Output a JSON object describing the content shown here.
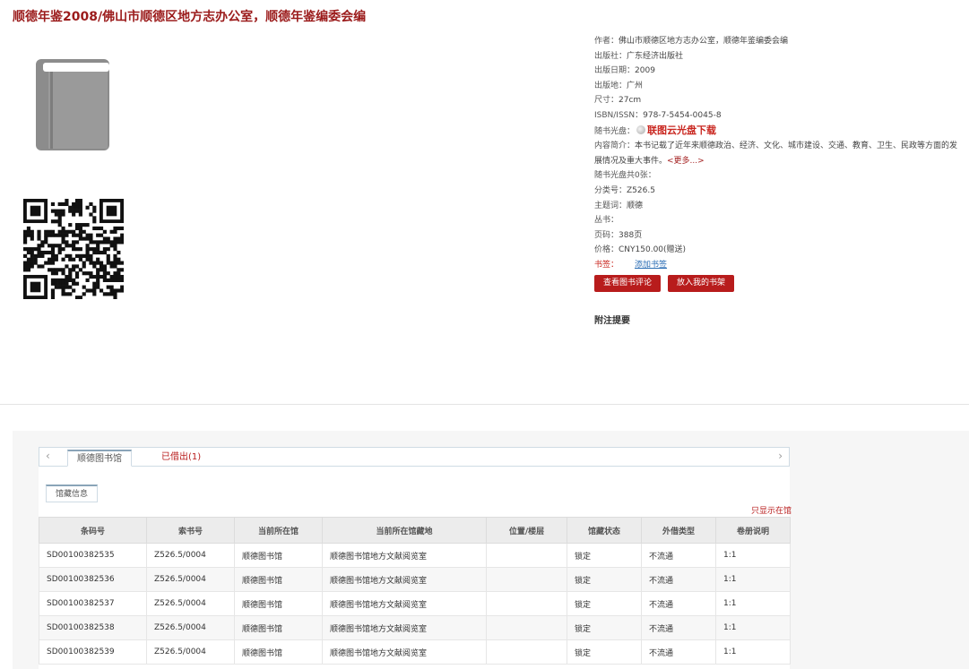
{
  "page": {
    "title": "顺德年鉴2008/佛山市顺德区地方志办公室，顺德年鉴编委会编"
  },
  "book_details": [
    {
      "label": "作者：",
      "value": "佛山市顺德区地方志办公室，顺德年鉴编委会编"
    },
    {
      "label": "出版社：",
      "value": "广东经济出版社"
    },
    {
      "label": "出版日期：",
      "value": "2009"
    },
    {
      "label": "出版地：",
      "value": "广州"
    },
    {
      "label": "尺寸：",
      "value": "27cm"
    },
    {
      "label": "ISBN/ISSN：",
      "value": "978-7-5454-0045-8"
    }
  ],
  "disc": {
    "label": "随书光盘：",
    "icon": "disc-icon",
    "link": "联图云光盘下载"
  },
  "description": {
    "label": "内容简介：",
    "text": "本书记载了近年来顺德政治、经济、文化、城市建设、交通、教育、卫生、民政等方面的发展情况及重大事件。",
    "more": "<更多...>"
  },
  "more_details": [
    {
      "label": "随书光盘共0张：",
      "value": ""
    },
    {
      "label": "分类号：",
      "value": "Z526.5"
    },
    {
      "label": "主题词：",
      "value": "顺德"
    },
    {
      "label": "丛书：",
      "value": ""
    },
    {
      "label": "页码：",
      "value": "388页"
    },
    {
      "label": "价格：",
      "value": "CNY150.00(赠送)"
    }
  ],
  "bookmark": {
    "label": "书签：",
    "link": "添加书签"
  },
  "actions": {
    "review": "查看图书评论",
    "shelf": "放入我的书架"
  },
  "notes_heading": "附注提要",
  "tabs": {
    "active": "顺德图书馆",
    "inactive": "已借出(1)",
    "left_arrow": "‹",
    "right_arrow": "›"
  },
  "subtab": "馆藏信息",
  "only_show": "只显示在馆",
  "holdings": {
    "headers": [
      "条码号",
      "索书号",
      "当前所在馆",
      "当前所在馆藏地",
      "位置/楼层",
      "馆藏状态",
      "外借类型",
      "卷册说明"
    ],
    "rows": [
      [
        "SD00100382535",
        "Z526.5/0004",
        "顺德图书馆",
        "顺德图书馆地方文献阅览室",
        "",
        "锁定",
        "不流通",
        "1:1"
      ],
      [
        "SD00100382536",
        "Z526.5/0004",
        "顺德图书馆",
        "顺德图书馆地方文献阅览室",
        "",
        "锁定",
        "不流通",
        "1:1"
      ],
      [
        "SD00100382537",
        "Z526.5/0004",
        "顺德图书馆",
        "顺德图书馆地方文献阅览室",
        "",
        "锁定",
        "不流通",
        "1:1"
      ],
      [
        "SD00100382538",
        "Z526.5/0004",
        "顺德图书馆",
        "顺德图书馆地方文献阅览室",
        "",
        "锁定",
        "不流通",
        "1:1"
      ],
      [
        "SD00100382539",
        "Z526.5/0004",
        "顺德图书馆",
        "顺德图书馆地方文献阅览室",
        "",
        "锁定",
        "不流通",
        "1:1"
      ]
    ]
  }
}
